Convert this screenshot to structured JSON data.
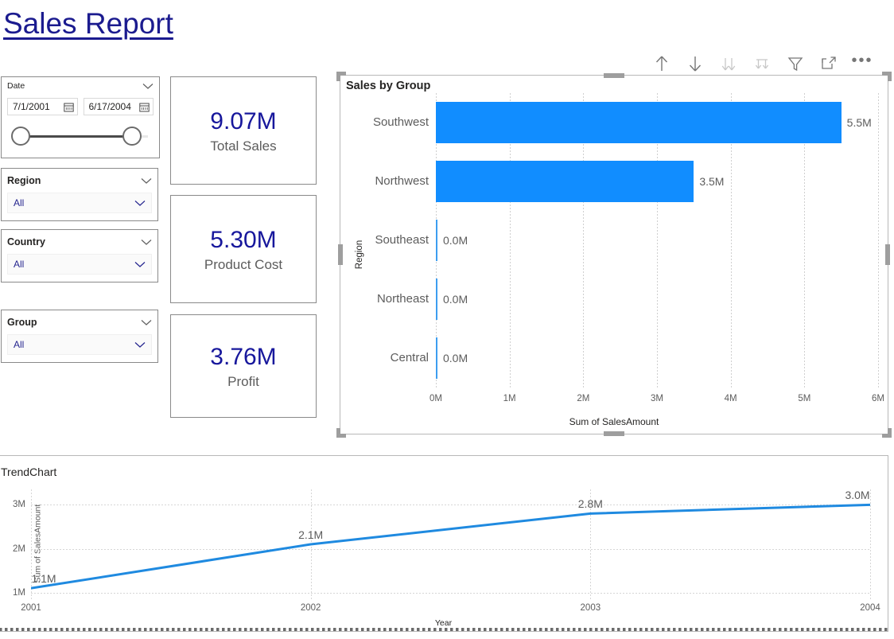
{
  "report": {
    "title": "Sales Report"
  },
  "toolbar": {
    "icons": [
      {
        "name": "drill-up-icon",
        "label": "Drill up",
        "dim": false
      },
      {
        "name": "drill-down-icon",
        "label": "Drill down",
        "dim": false
      },
      {
        "name": "expand-all-icon",
        "label": "Expand all down one level",
        "dim": true
      },
      {
        "name": "drill-down-hierarchy-icon",
        "label": "Go to next level",
        "dim": true
      },
      {
        "name": "filter-icon",
        "label": "Filters",
        "dim": false
      },
      {
        "name": "focus-mode-icon",
        "label": "Focus mode",
        "dim": false
      },
      {
        "name": "more-options-icon",
        "label": "More options",
        "dim": false
      }
    ],
    "more_glyph": "•••"
  },
  "slicers": {
    "date": {
      "title": "Date",
      "start": "7/1/2001",
      "end": "6/17/2004",
      "calendar_icon": "calendar-icon"
    },
    "region": {
      "title": "Region",
      "value": "All"
    },
    "country": {
      "title": "Country",
      "value": "All"
    },
    "group": {
      "title": "Group",
      "value": "All"
    }
  },
  "kpis": [
    {
      "value": "9.07M",
      "label": "Total Sales"
    },
    {
      "value": "5.30M",
      "label": "Product Cost"
    },
    {
      "value": "3.76M",
      "label": "Profit"
    }
  ],
  "colors": {
    "accent_blue": "#118dff",
    "title_navy": "#1b1b8f",
    "kpi_value": "#17179c",
    "axis_text": "#5c5c5c",
    "line_blue": "#1f8ae0"
  },
  "chart_data": [
    {
      "type": "bar",
      "orientation": "horizontal",
      "title": "Sales by Group",
      "categories": [
        "Southwest",
        "Northwest",
        "Southeast",
        "Northeast",
        "Central"
      ],
      "values": [
        5.5,
        3.5,
        0.0,
        0.0,
        0.0
      ],
      "data_labels": [
        "5.5M",
        "3.5M",
        "0.0M",
        "0.0M",
        "0.0M"
      ],
      "xlabel": "Sum of SalesAmount",
      "ylabel": "Region",
      "xlim": [
        0,
        6
      ],
      "xticks": [
        0,
        1,
        2,
        3,
        4,
        5,
        6
      ],
      "xticklabels": [
        "0M",
        "1M",
        "2M",
        "3M",
        "4M",
        "5M",
        "6M"
      ],
      "grid": true,
      "legend": "none",
      "series_color": "#118dff"
    },
    {
      "type": "line",
      "title": "TrendChart",
      "x": [
        2001,
        2002,
        2003,
        2004
      ],
      "xticklabels": [
        "2001",
        "2002",
        "2003",
        "2004"
      ],
      "values": [
        1.1,
        2.1,
        2.8,
        3.0
      ],
      "data_labels": [
        "1.1M",
        "2.1M",
        "2.8M",
        "3.0M"
      ],
      "xlabel": "Year",
      "ylabel": "Sum of SalesAmount",
      "ylim": [
        0.85,
        3.35
      ],
      "yticks": [
        1,
        2,
        3
      ],
      "yticklabels": [
        "1M",
        "2M",
        "3M"
      ],
      "grid": true,
      "legend": "none",
      "series_color": "#1f8ae0"
    }
  ]
}
